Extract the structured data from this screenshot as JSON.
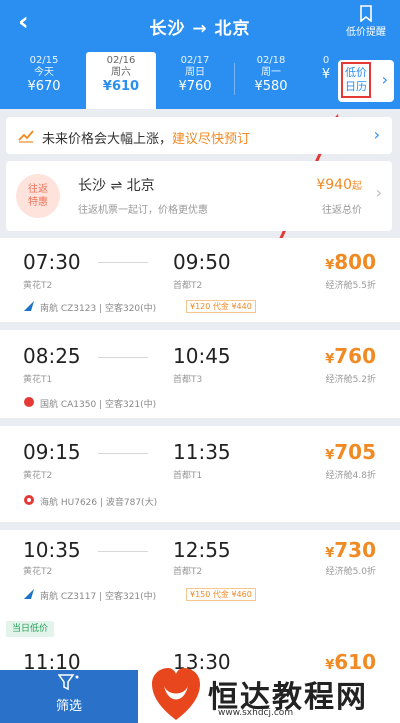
{
  "header": {
    "back_icon": "chevron-left-icon",
    "title": "长沙 → 北京",
    "alert_label": "低价提醒",
    "alert_icon": "bookmark-icon"
  },
  "dates": [
    {
      "date": "02/15",
      "day": "今天",
      "price": "¥670"
    },
    {
      "date": "02/16",
      "day": "周六",
      "price": "¥610",
      "selected": true
    },
    {
      "date": "02/17",
      "day": "周日",
      "price": "¥760"
    },
    {
      "date": "02/18",
      "day": "周一",
      "price": "¥580"
    },
    {
      "date": "0",
      "day": "",
      "price": "¥"
    }
  ],
  "calendar": {
    "label_line1": "低价",
    "label_line2": "日历"
  },
  "tip": {
    "text_prefix": "未来价格会大幅上涨，",
    "text_link": "建议尽快预订",
    "icon": "trend-up-icon"
  },
  "round_trip": {
    "badge_line1": "往返",
    "badge_line2": "特惠",
    "title": "长沙 ⇌ 北京",
    "subtitle": "往返机票一起订，价格更优惠",
    "price": "¥940",
    "price_suffix": "起",
    "price_label": "往返总价"
  },
  "flights": [
    {
      "dep_time": "07:30",
      "dep_airport": "黄花T2",
      "arr_time": "09:50",
      "arr_airport": "首都T2",
      "price": "800",
      "discount": "经济舱5.5折",
      "airline": "南航 CZ3123 | 空客320(中)",
      "tag": "¥120 代金 ¥440",
      "logo_color": "#1a73c8"
    },
    {
      "dep_time": "08:25",
      "dep_airport": "黄花T1",
      "arr_time": "10:45",
      "arr_airport": "首都T3",
      "price": "760",
      "discount": "经济舱5.2折",
      "airline": "国航 CA1350 | 空客321(中)",
      "tag": "",
      "logo_color": "#e53935"
    },
    {
      "dep_time": "09:15",
      "dep_airport": "黄花T2",
      "arr_time": "11:35",
      "arr_airport": "首都T1",
      "price": "705",
      "discount": "经济舱4.8折",
      "airline": "海航 HU7626 | 波音787(大)",
      "tag": "",
      "logo_color": "#e53935"
    },
    {
      "dep_time": "10:35",
      "dep_airport": "黄花T2",
      "arr_time": "12:55",
      "arr_airport": "首都T2",
      "price": "730",
      "discount": "经济舱5.0折",
      "airline": "南航 CZ3117 | 空客321(中)",
      "tag": "¥150 代金 ¥460",
      "logo_color": "#1a73c8"
    },
    {
      "dep_time": "11:10",
      "dep_airport": "",
      "arr_time": "13:30",
      "arr_airport": "",
      "price": "610",
      "discount": "",
      "airline": "",
      "tag": "",
      "logo_color": "#1a73c8"
    }
  ],
  "day_label": "当日低价",
  "footer": {
    "filter_label": "筛选",
    "filter_icon": "filter-icon"
  },
  "watermark": {
    "text": "恒达教程网",
    "url": "www.sxhdcj.com",
    "logo_icon": "heart-logo-icon"
  },
  "currency_symbol": "¥",
  "colors": {
    "primary": "#2a8ff0",
    "price": "#f08a24",
    "highlight": "#e53935"
  }
}
